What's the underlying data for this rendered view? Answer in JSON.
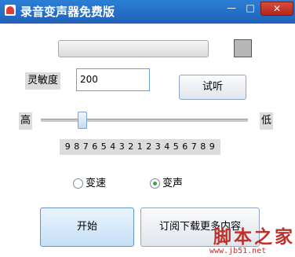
{
  "window": {
    "title": "录音变声器免费版",
    "min_symbol": "—",
    "max_symbol": "□",
    "close_symbol": "✕"
  },
  "controls": {
    "sensitivity_label": "灵敏度",
    "sensitivity_value": "200",
    "listen_button": "试听",
    "high_label": "高",
    "low_label": "低",
    "scale_text": "9 8 7 6 5 4 3 2 1 2 3 4 5 6 7 8 9",
    "speed_radio_label": "变速",
    "voice_radio_label": "变声",
    "selected_mode": "变声",
    "start_button": "开始",
    "download_button": "订阅下载更多内容"
  },
  "watermark": {
    "text": "脚本之家",
    "url": "www.jb51.net"
  },
  "colors": {
    "titlebar": "#1f62b8",
    "close_button": "#c2332a",
    "radio_checked": "#2fae2f",
    "swatch": "#b7b7b7",
    "watermark": "#c0302a"
  }
}
